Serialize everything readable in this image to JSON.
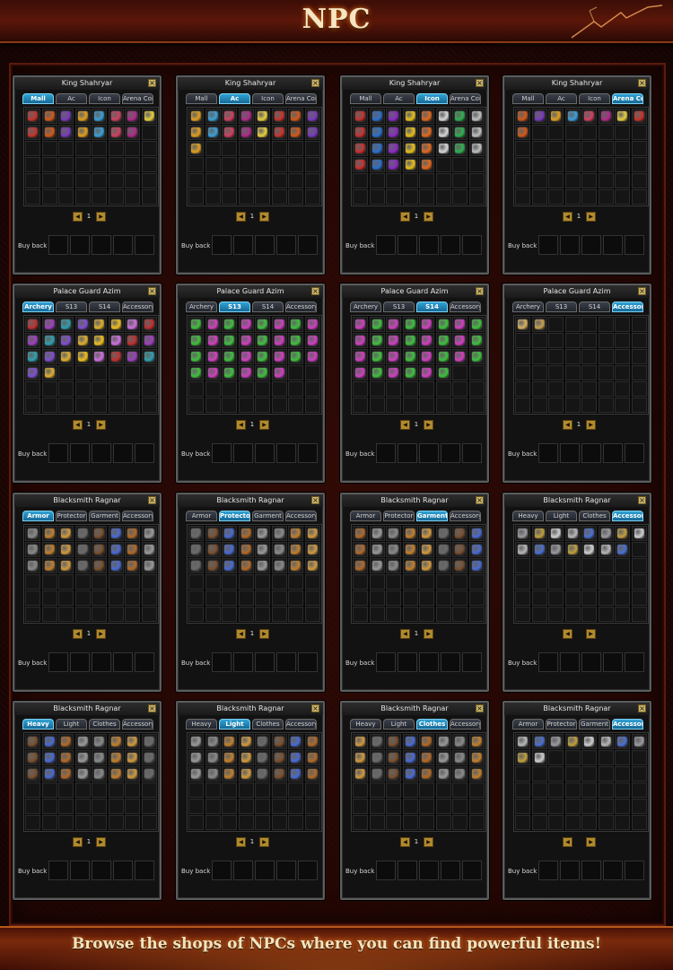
{
  "page": {
    "title": "NPC",
    "caption": "Browse the shops of NPCs where you can find powerful items!"
  },
  "colors": {
    "active_tab": "#2fa3d6",
    "title_glow": "#ff7a1a",
    "frame": "#5a1a0c"
  },
  "panels": [
    {
      "npc": "King Shahryar",
      "tabs": [
        "Mall",
        "Ac",
        "Icon",
        "Arena Coin"
      ],
      "active_tab": 0,
      "page": "1",
      "buyback_label": "Buy back",
      "item_count": 15,
      "theme": "shop-mixed"
    },
    {
      "npc": "King Shahryar",
      "tabs": [
        "Mall",
        "Ac",
        "Icon",
        "Arena Coin"
      ],
      "active_tab": 1,
      "page": "1",
      "buyback_label": "Buy back",
      "item_count": 17,
      "theme": "shop-mixed"
    },
    {
      "npc": "King Shahryar",
      "tabs": [
        "Mall",
        "Ac",
        "Icon",
        "Arena Coin"
      ],
      "active_tab": 2,
      "page": "1",
      "buyback_label": "Buy back",
      "item_count": 29,
      "theme": "icons"
    },
    {
      "npc": "King Shahryar",
      "tabs": [
        "Mall",
        "Ac",
        "Icon",
        "Arena Coin"
      ],
      "active_tab": 3,
      "page": "1",
      "buyback_label": "Buy back",
      "item_count": 9,
      "theme": "shop-mixed"
    },
    {
      "npc": "Palace Guard Azim",
      "tabs": [
        "Archery",
        "S13",
        "S14",
        "Accessory"
      ],
      "active_tab": 0,
      "page": "1",
      "buyback_label": "Buy back",
      "item_count": 26,
      "theme": "archery"
    },
    {
      "npc": "Palace Guard Azim",
      "tabs": [
        "Archery",
        "S13",
        "S14",
        "Accessory"
      ],
      "active_tab": 1,
      "page": "1",
      "buyback_label": "Buy back",
      "item_count": 30,
      "theme": "pink-green"
    },
    {
      "npc": "Palace Guard Azim",
      "tabs": [
        "Archery",
        "S13",
        "S14",
        "Accessory"
      ],
      "active_tab": 2,
      "page": "1",
      "buyback_label": "Buy back",
      "item_count": 30,
      "theme": "pink-green"
    },
    {
      "npc": "Palace Guard Azim",
      "tabs": [
        "Archery",
        "S13",
        "S14",
        "Accessory"
      ],
      "active_tab": 3,
      "page": "1",
      "buyback_label": "Buy back",
      "item_count": 2,
      "theme": "gold"
    },
    {
      "npc": "Blacksmith Ragnar",
      "tabs": [
        "Armor",
        "Protector",
        "Garment",
        "Accessory"
      ],
      "active_tab": 0,
      "page": "1",
      "buyback_label": "Buy back",
      "item_count": 24,
      "theme": "armor"
    },
    {
      "npc": "Blacksmith Ragnar",
      "tabs": [
        "Armor",
        "Protector",
        "Garment",
        "Accessory"
      ],
      "active_tab": 1,
      "page": "1",
      "buyback_label": "Buy back",
      "item_count": 24,
      "theme": "armor"
    },
    {
      "npc": "Blacksmith Ragnar",
      "tabs": [
        "Armor",
        "Protector",
        "Garment",
        "Accessory"
      ],
      "active_tab": 2,
      "page": "1",
      "buyback_label": "Buy back",
      "item_count": 24,
      "theme": "armor"
    },
    {
      "npc": "Blacksmith Ragnar",
      "tabs": [
        "Heavy",
        "Light",
        "Clothes",
        "Accessory"
      ],
      "active_tab": 3,
      "page": "",
      "buyback_label": "Buy back",
      "item_count": 15,
      "theme": "silver"
    },
    {
      "npc": "Blacksmith Ragnar",
      "tabs": [
        "Heavy",
        "Light",
        "Clothes",
        "Accessory"
      ],
      "active_tab": 0,
      "page": "1",
      "buyback_label": "Buy back",
      "item_count": 24,
      "theme": "armor"
    },
    {
      "npc": "Blacksmith Ragnar",
      "tabs": [
        "Heavy",
        "Light",
        "Clothes",
        "Accessory"
      ],
      "active_tab": 1,
      "page": "1",
      "buyback_label": "Buy back",
      "item_count": 24,
      "theme": "armor"
    },
    {
      "npc": "Blacksmith Ragnar",
      "tabs": [
        "Heavy",
        "Light",
        "Clothes",
        "Accessory"
      ],
      "active_tab": 2,
      "page": "1",
      "buyback_label": "Buy back",
      "item_count": 24,
      "theme": "armor"
    },
    {
      "npc": "Blacksmith Ragnar",
      "tabs": [
        "Armor",
        "Protector",
        "Garment",
        "Accessory"
      ],
      "active_tab": 3,
      "page": "",
      "buyback_label": "Buy back",
      "item_count": 10,
      "theme": "silver"
    }
  ]
}
